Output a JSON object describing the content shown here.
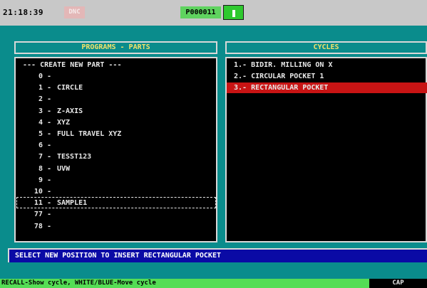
{
  "topbar": {
    "time": "21:18:39",
    "dnc_label": "DNC",
    "program_number": "P000011"
  },
  "parts_panel": {
    "title": "PROGRAMS - PARTS",
    "create_new": "--- CREATE NEW PART ---",
    "items": [
      {
        "num": "0 -",
        "name": ""
      },
      {
        "num": "1 -",
        "name": "CIRCLE"
      },
      {
        "num": "2 -",
        "name": ""
      },
      {
        "num": "3 -",
        "name": "Z-AXIS"
      },
      {
        "num": "4 -",
        "name": "XYZ"
      },
      {
        "num": "5 -",
        "name": "FULL TRAVEL XYZ"
      },
      {
        "num": "6 -",
        "name": ""
      },
      {
        "num": "7 -",
        "name": "TESST123"
      },
      {
        "num": "8 -",
        "name": "UVW"
      },
      {
        "num": "9 -",
        "name": ""
      },
      {
        "num": "10 -",
        "name": ""
      },
      {
        "num": "11 -",
        "name": "SAMPLE1"
      },
      {
        "num": "77 -",
        "name": ""
      },
      {
        "num": "78 -",
        "name": ""
      }
    ]
  },
  "cycles_panel": {
    "title": "CYCLES",
    "items": [
      "1.- BIDIR. MILLING ON X",
      "2.- CIRCULAR POCKET 1",
      "3.- RECTANGULAR POCKET"
    ]
  },
  "message": "SELECT NEW POSITION TO INSERT RECTANGULAR POCKET",
  "statusbar": {
    "hint": "RECALL-Show cycle, WHITE/BLUE-Move cycle",
    "cap": "CAP"
  },
  "colors": {
    "background": "#0a8c8c",
    "title_text": "#f0e26a",
    "highlight": "#c81414",
    "message_bg": "#0a0aa5",
    "status_green": "#55dd55"
  }
}
